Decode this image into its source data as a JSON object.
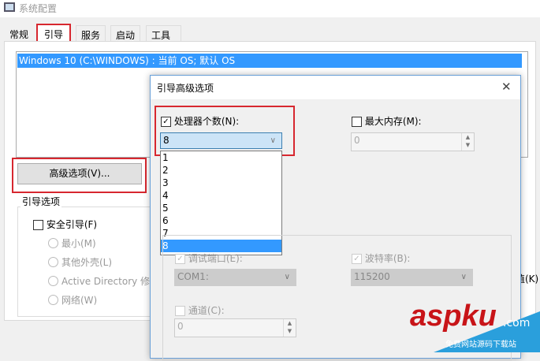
{
  "window": {
    "title": "系统配置",
    "tabs": [
      "常规",
      "引导",
      "服务",
      "启动",
      "工具"
    ],
    "active_tab": "引导"
  },
  "boot_list": {
    "selected": "Windows 10 (C:\\WINDOWS) : 当前 OS; 默认 OS"
  },
  "advanced_button": "高级选项(V)...",
  "boot_options": {
    "label": "引导选项",
    "safe_boot": "安全引导(F)",
    "radios": [
      "最小(M)",
      "其他外壳(L)",
      "Active Directory 修",
      "网络(W)"
    ],
    "right_fragment": "值(K)"
  },
  "dialog": {
    "title": "引导高级选项",
    "close": "✕",
    "num_proc": {
      "label": "处理器个数(N):",
      "checked": true,
      "value": "8",
      "options": [
        "1",
        "2",
        "3",
        "4",
        "5",
        "6",
        "7",
        "8"
      ]
    },
    "max_mem": {
      "label": "最大内存(M):",
      "checked": false,
      "value": "0"
    },
    "debug_port": {
      "label": "调试端口(E):",
      "value": "COM1:"
    },
    "baud": {
      "label": "波特率(B):",
      "value": "115200"
    },
    "channel": {
      "label": "通道(C):",
      "value": "0"
    }
  },
  "watermark": {
    "brand": "aspku",
    "suffix": ".com",
    "tagline": "免费网站源码下载站"
  },
  "colors": {
    "accent": "#3399ff",
    "highlight": "#d7272f"
  }
}
